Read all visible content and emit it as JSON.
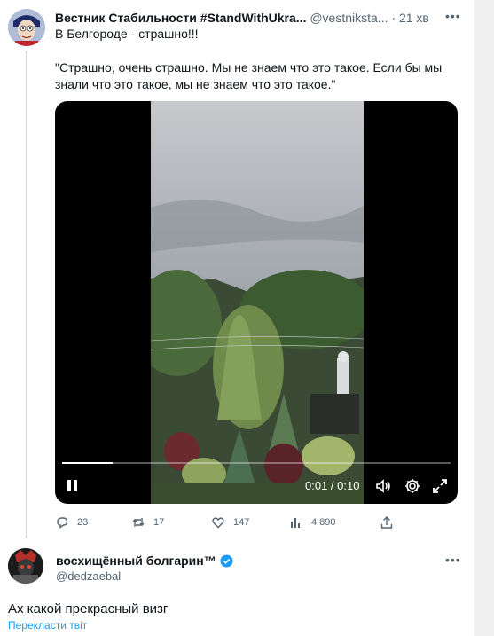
{
  "tweet1": {
    "author_name": "Вестник Стабильности #StandWithUkra...",
    "handle": "@vestniksta...",
    "separator": "·",
    "time": "21 хв",
    "text_line1": "В Белгороде - страшно!!!",
    "text_quote": "\"Страшно, очень страшно. Мы не знаем что это такое. Если бы мы знали что это такое, мы не знаем что это такое.\"",
    "video": {
      "time_readout": "0:01 / 0:10",
      "progress": 0.13
    },
    "actions": {
      "replies": "23",
      "retweets": "17",
      "likes": "147",
      "views": "4 890"
    },
    "more_icon": "more-dots-icon"
  },
  "tweet2": {
    "author_name": "восхищённый болгарин™",
    "handle": "@dedzaebal",
    "text": "Ах какой прекрасный визг",
    "translate_link": "Перекласти твіт",
    "verified_color": "#1d9bf0"
  },
  "colors": {
    "accent": "#1d9bf0",
    "secondary_text": "#536471",
    "primary_text": "#0f1419"
  }
}
